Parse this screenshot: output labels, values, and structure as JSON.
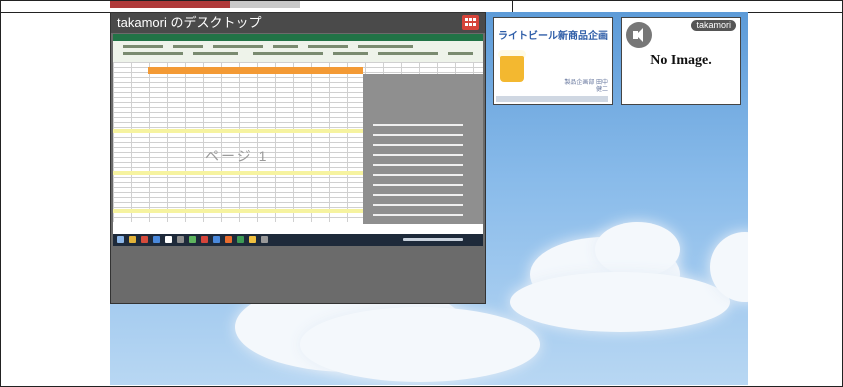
{
  "share_window": {
    "title": "takamori のデスクトップ",
    "watermark": "ページ 1"
  },
  "participants": [
    {
      "title": "ライトビール新商品企画",
      "subtitle": "製品企画部 田中健二"
    },
    {
      "user": "takamori",
      "placeholder": "No Image."
    }
  ],
  "colors": {
    "accent": "#d6443a",
    "sky": "#89bbea",
    "window_bg": "#6b6b6b"
  }
}
